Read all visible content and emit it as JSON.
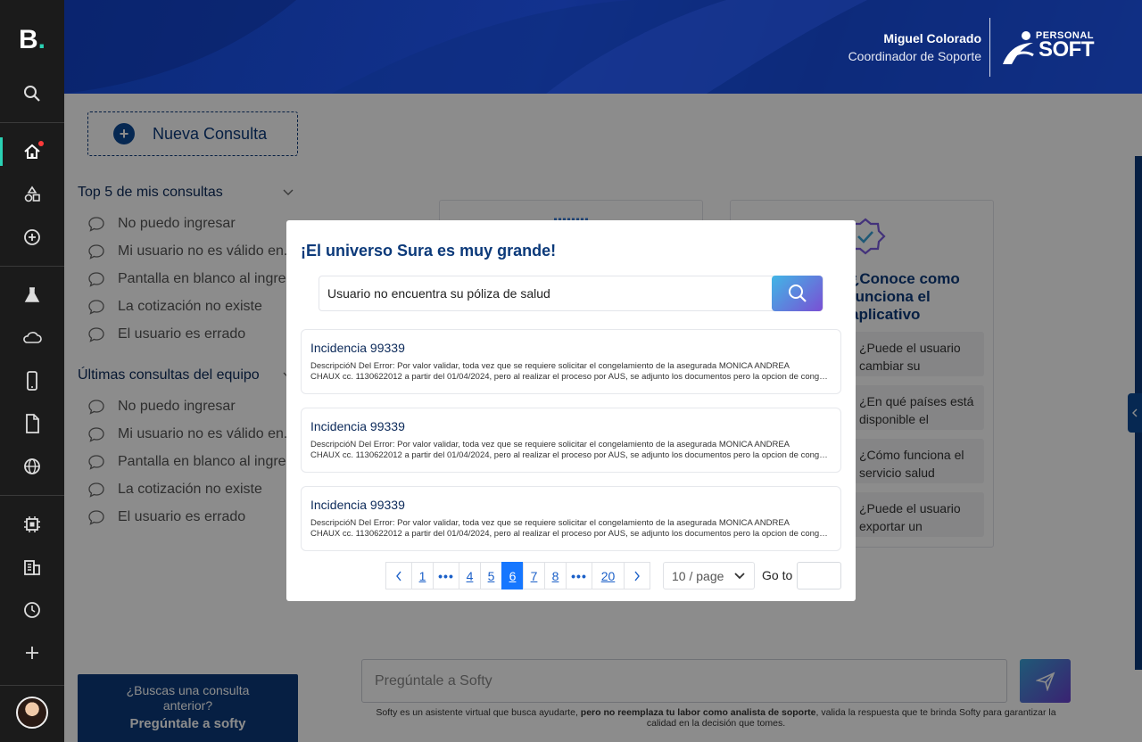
{
  "app": {
    "logo": "B",
    "logo_dot": "."
  },
  "header": {
    "user_name": "Miguel Colorado",
    "user_role": "Coordinador de Soporte",
    "brand_top": "PERSONAL",
    "brand_bottom": "SOFT"
  },
  "rail": {
    "icons": [
      "search-icon",
      "home-icon",
      "shapes-icon",
      "add-circle-icon",
      "flask-icon",
      "cloud-icon",
      "mobile-icon",
      "document-icon",
      "globe-icon",
      "chip-icon",
      "building-icon",
      "clock-icon",
      "plus-icon"
    ]
  },
  "left": {
    "new_query": "Nueva Consulta",
    "top5_title": "Top 5 de mis consultas",
    "top5": [
      "No puedo ingresar",
      "Mi usuario no es válido en...",
      "Pantalla en blanco al ingresar",
      "La cotización no existe",
      "El usuario es errado"
    ],
    "team_title": "Últimas consultas del equipo",
    "team": [
      "No puedo ingresar",
      "Mi usuario no es válido en...",
      "Pantalla en blanco al ingresar",
      "La cotización no existe",
      "El usuario es errado"
    ],
    "cta_line1": "¿Buscas una consulta anterior?",
    "cta_line2": "Pregúntale a softy"
  },
  "main": {
    "card_title": "¿Conoce como funciona el aplicativo",
    "options": [
      "¿Puede el usuario cambiar su",
      "¿En qué países está disponible el",
      "¿Cómo funciona el servicio salud",
      "¿Puede el usuario exportar un"
    ],
    "chat_placeholder": "Pregúntale a Softy",
    "disclaimer_a": "Softy es un asistente virtual que busca ayudarte, ",
    "disclaimer_b": "pero no reemplaza tu labor como analista de soporte",
    "disclaimer_c": ", valida la respuesta que te brinda Softy para garantizar la calidad en la decisión que tomes."
  },
  "modal": {
    "title": "¡El universo Sura es muy grande!",
    "search_value": "Usuario no encuentra su póliza de salud",
    "results": [
      {
        "title": "Incidencia 99339",
        "line1": "DescripcióN Del Error: Por valor validar, toda vez que se requiere solicitar el congelamiento de la asegurada MONICA ANDREA",
        "line2": "CHAUX cc. 1130622012  a partir del 01/04/2024, pero al realizar el proceso por AUS, se adjunto los documentos pero la opcion de congelamiento"
      },
      {
        "title": "Incidencia 99339",
        "line1": "DescripcióN Del Error: Por valor validar, toda vez que se requiere solicitar el congelamiento de la asegurada MONICA ANDREA",
        "line2": "CHAUX cc. 1130622012  a partir del 01/04/2024, pero al realizar el proceso por AUS, se adjunto los documentos pero la opcion de congelamiento"
      },
      {
        "title": "Incidencia 99339",
        "line1": "DescripcióN Del Error: Por valor validar, toda vez que se requiere solicitar el congelamiento de la asegurada MONICA ANDREA",
        "line2": "CHAUX cc. 1130622012  a partir del 01/04/2024, pero al realizar el proceso por AUS, se adjunto los documentos pero la opcion de congelamiento"
      }
    ],
    "pages": [
      "1",
      "•••",
      "4",
      "5",
      "6",
      "7",
      "8",
      "•••",
      "20"
    ],
    "current_page": "6",
    "page_size": "10 / page",
    "goto_label": "Go to"
  },
  "colors": {
    "primary": "#0c3a7a",
    "accent": "#2ad1b4",
    "active_page": "#1677ff"
  }
}
